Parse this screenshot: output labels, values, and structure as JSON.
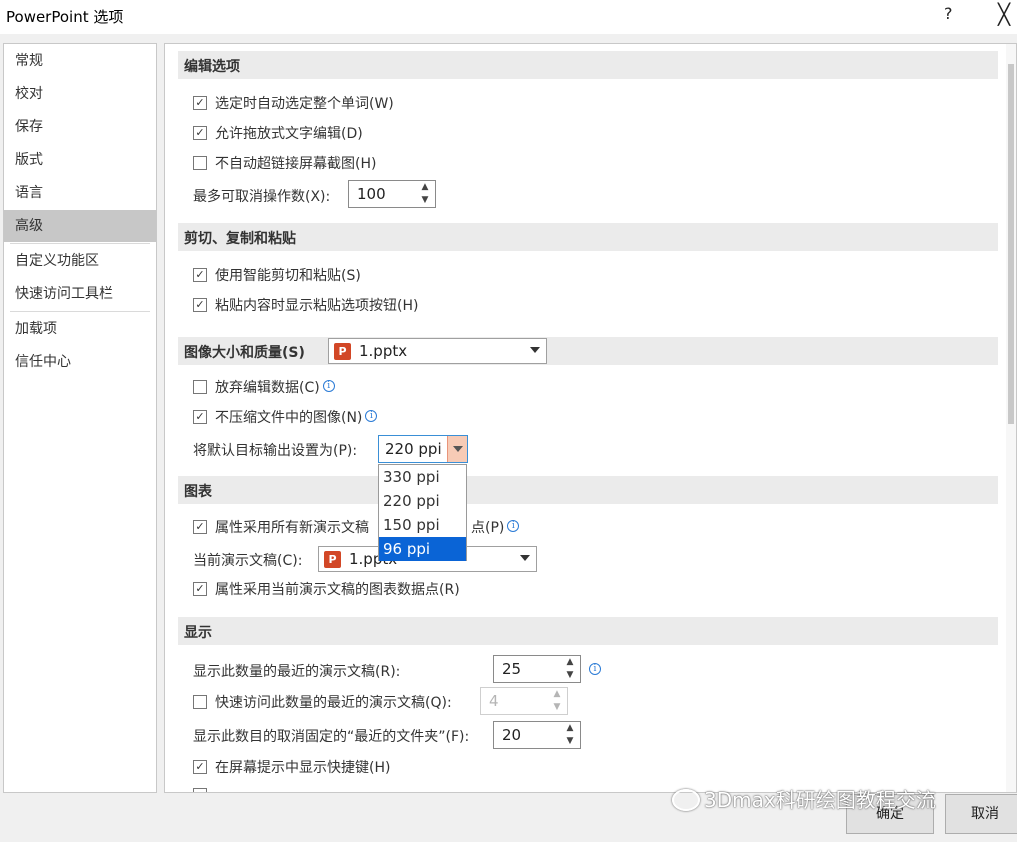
{
  "window": {
    "title": "PowerPoint 选项",
    "help": "?",
    "close": "╳"
  },
  "nav": [
    "常规",
    "校对",
    "保存",
    "版式",
    "语言",
    "高级",
    "自定义功能区",
    "快速访问工具栏",
    "加载项",
    "信任中心"
  ],
  "sections": {
    "edit": "编辑选项",
    "paste": "剪切、复制和粘贴",
    "image": "图像大小和质量(S)",
    "chart": "图表",
    "display": "显示"
  },
  "edit": {
    "select_word": "选定时自动选定整个单词(W)",
    "drag_drop": "允许拖放式文字编辑(D)",
    "no_hyperlink": "不自动超链接屏幕截图(H)",
    "undo_label": "最多可取消操作数(X):",
    "undo_value": "100"
  },
  "paste": {
    "smart": "使用智能剪切和粘贴(S)",
    "show_btn": "粘贴内容时显示粘贴选项按钮(H)"
  },
  "image": {
    "file": "1.pptx",
    "discard": "放弃编辑数据(C)",
    "no_compress": "不压缩文件中的图像(N)",
    "target_label": "将默认目标输出设置为(P):",
    "target_value": "220 ppi",
    "options": [
      "330 ppi",
      "220 ppi",
      "150 ppi",
      "96 ppi"
    ],
    "selected_option": "96 ppi"
  },
  "chart": {
    "all_new_prefix": "属性采用所有新演示文稿",
    "all_new_suffix": "点(P)",
    "current_label": "当前演示文稿(C):",
    "current_file": "1.pptx",
    "current_points": "属性采用当前演示文稿的图表数据点(R)"
  },
  "display": {
    "recent_label": "显示此数量的最近的演示文稿(R):",
    "recent_value": "25",
    "quick_label": "快速访问此数量的最近的演示文稿(Q):",
    "quick_value": "4",
    "folders_label": "显示此数目的取消固定的“最近的文件夹”(F):",
    "folders_value": "20",
    "shortcut": "在屏幕提示中显示快捷键(H)"
  },
  "buttons": {
    "ok": "确定",
    "cancel": "取消"
  },
  "watermark": "3Dmax科研绘图教程交流",
  "colors": {
    "selection": "#0a64d6",
    "ppi_button": "#f7cbb6",
    "info": "#2b7bd6"
  }
}
